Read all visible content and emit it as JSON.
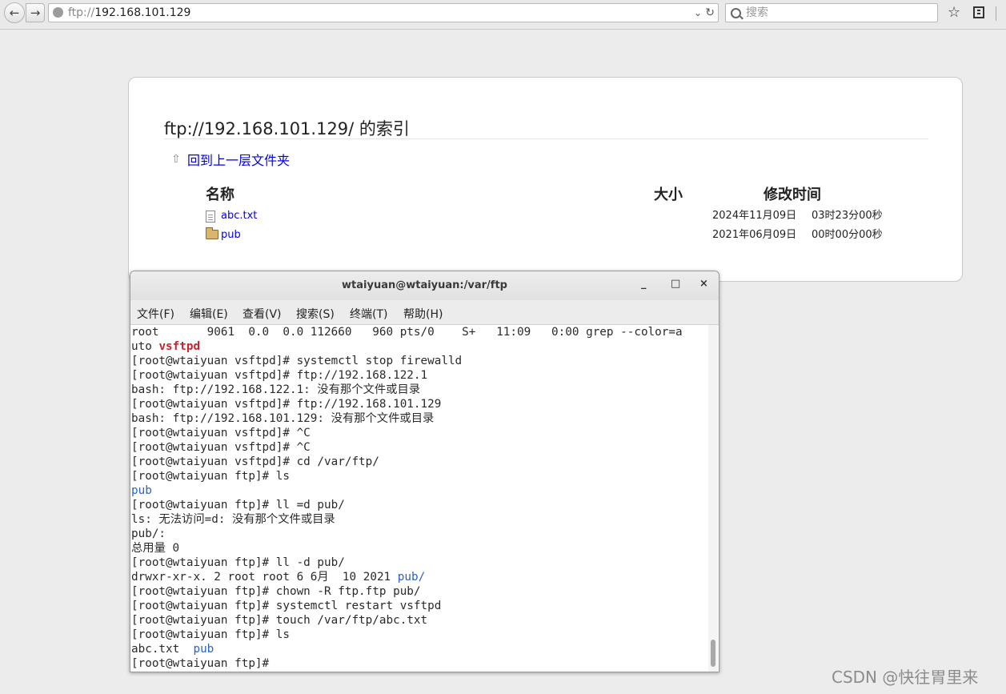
{
  "browser": {
    "url_protocol": "ftp://",
    "url_host": "192.168.101.129",
    "search_placeholder": "搜索",
    "back_icon": "arrow-left-icon",
    "forward_icon": "arrow-right-icon"
  },
  "page": {
    "title": "ftp://192.168.101.129/ 的索引",
    "up_link": "回到上一层文件夹",
    "columns": {
      "name": "名称",
      "size": "大小",
      "time": "修改时间"
    },
    "files": [
      {
        "name": "abc.txt",
        "icon": "text-file-icon",
        "date": "2024年11月09日",
        "time": "03时23分00秒"
      },
      {
        "name": "pub",
        "icon": "folder-icon",
        "date": "2021年06月09日",
        "time": "00时00分00秒"
      }
    ]
  },
  "terminal": {
    "title": "wtaiyuan@wtaiyuan:/var/ftp",
    "buttons": {
      "minimize": "_",
      "maximize": "□",
      "close": "×"
    },
    "menu": [
      "文件(F)",
      "编辑(E)",
      "查看(V)",
      "搜索(S)",
      "终端(T)",
      "帮助(H)"
    ],
    "lines": [
      [
        {
          "t": "root       9061  0.0  0.0 112660   960 pts/0    S+   11:09   0:00 grep --color=a"
        }
      ],
      [
        {
          "t": "uto "
        },
        {
          "t": "vsftpd",
          "c": "hl"
        }
      ],
      [
        {
          "t": "[root@wtaiyuan vsftpd]# systemctl stop firewalld"
        }
      ],
      [
        {
          "t": "[root@wtaiyuan vsftpd]# ftp://192.168.122.1"
        }
      ],
      [
        {
          "t": "bash: ftp://192.168.122.1: 没有那个文件或目录"
        }
      ],
      [
        {
          "t": "[root@wtaiyuan vsftpd]# ftp://192.168.101.129"
        }
      ],
      [
        {
          "t": "bash: ftp://192.168.101.129: 没有那个文件或目录"
        }
      ],
      [
        {
          "t": "[root@wtaiyuan vsftpd]# ^C"
        }
      ],
      [
        {
          "t": "[root@wtaiyuan vsftpd]# ^C"
        }
      ],
      [
        {
          "t": "[root@wtaiyuan vsftpd]# cd /var/ftp/"
        }
      ],
      [
        {
          "t": "[root@wtaiyuan ftp]# ls"
        }
      ],
      [
        {
          "t": "pub",
          "c": "blue"
        }
      ],
      [
        {
          "t": "[root@wtaiyuan ftp]# ll =d pub/"
        }
      ],
      [
        {
          "t": "ls: 无法访问=d: 没有那个文件或目录"
        }
      ],
      [
        {
          "t": "pub/:"
        }
      ],
      [
        {
          "t": "总用量 0"
        }
      ],
      [
        {
          "t": "[root@wtaiyuan ftp]# ll -d pub/"
        }
      ],
      [
        {
          "t": "drwxr-xr-x. 2 root root 6 6月  10 2021 "
        },
        {
          "t": "pub/",
          "c": "blue"
        }
      ],
      [
        {
          "t": "[root@wtaiyuan ftp]# chown -R ftp.ftp pub/"
        }
      ],
      [
        {
          "t": "[root@wtaiyuan ftp]# systemctl restart vsftpd"
        }
      ],
      [
        {
          "t": "[root@wtaiyuan ftp]# touch /var/ftp/abc.txt"
        }
      ],
      [
        {
          "t": "[root@wtaiyuan ftp]# ls"
        }
      ],
      [
        {
          "t": "abc.txt  "
        },
        {
          "t": "pub",
          "c": "blue"
        }
      ],
      [
        {
          "t": "[root@wtaiyuan ftp]# "
        }
      ]
    ]
  },
  "watermark": "CSDN @快往胃里来"
}
